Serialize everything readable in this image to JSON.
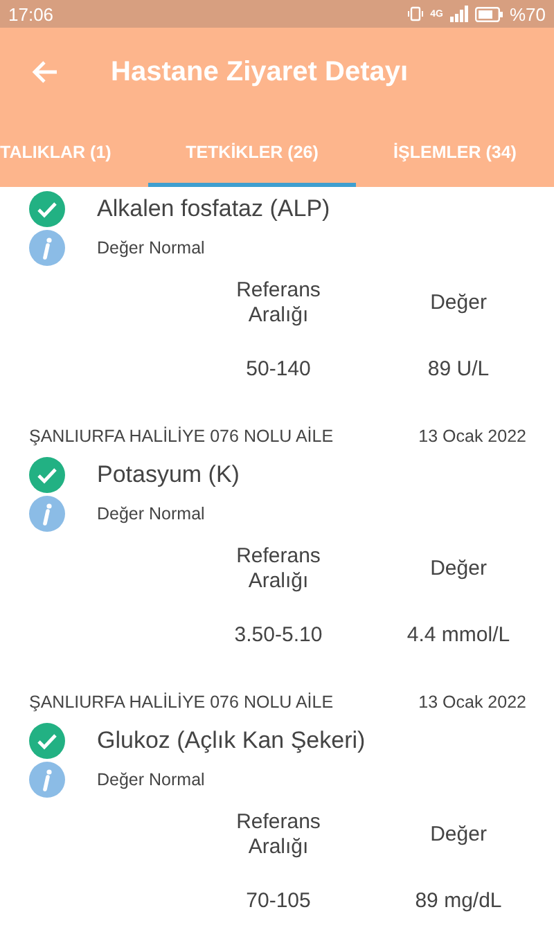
{
  "status_bar": {
    "time": "17:06",
    "network": "4G",
    "battery_text": "%70"
  },
  "app_bar": {
    "title": "Hastane Ziyaret Detayı"
  },
  "tabs": [
    {
      "label": "TALIKLAR (1)",
      "selected": false
    },
    {
      "label": "TETKİKLER (26)",
      "selected": true
    },
    {
      "label": "İŞLEMLER (34)",
      "selected": false
    }
  ],
  "tests": [
    {
      "name": "Alkalen fosfataz (ALP)",
      "normal": true,
      "status": "Değer Normal",
      "columns": [
        "Referans Aralığı",
        "Değer"
      ],
      "reference": "50-140",
      "value": "89 U/L"
    },
    {
      "facility": "ŞANLIURFA HALİLİYE 076 NOLU AİLE",
      "date": "13 Ocak 2022",
      "name": "Potasyum (K)",
      "normal": true,
      "status": "Değer Normal",
      "columns": [
        "Referans Aralığı",
        "Değer"
      ],
      "reference": "3.50-5.10",
      "value": "4.4 mmol/L"
    },
    {
      "facility": "ŞANLIURFA HALİLİYE 076 NOLU AİLE",
      "date": "13 Ocak 2022",
      "name": "Glukoz (Açlık Kan Şekeri)",
      "normal": true,
      "status": "Değer Normal",
      "columns": [
        "Referans Aralığı",
        "Değer"
      ],
      "reference": "70-105",
      "value": "89 mg/dL"
    }
  ]
}
